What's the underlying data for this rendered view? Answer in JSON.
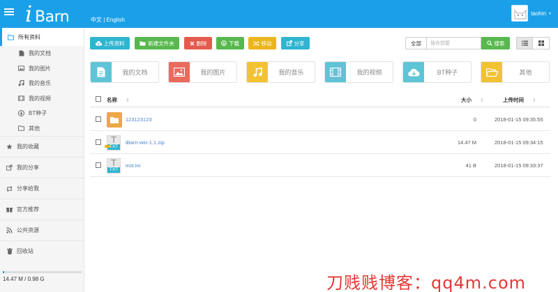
{
  "header": {
    "logo_i": "i",
    "logo_rest": "Barn",
    "lang_zh": "中文",
    "lang_sep": " | ",
    "lang_en": "English",
    "username": "taohin",
    "caret": "▾"
  },
  "sidebar": {
    "all_files": "所有资料",
    "sub_items": [
      {
        "label": "我的文档",
        "icon": "file-icon"
      },
      {
        "label": "我的图片",
        "icon": "image-icon"
      },
      {
        "label": "我的音乐",
        "icon": "music-icon"
      },
      {
        "label": "我的视频",
        "icon": "film-icon"
      },
      {
        "label": "BT种子",
        "icon": "download-circle-icon"
      },
      {
        "label": "其他",
        "icon": "folder-icon"
      }
    ],
    "main_items": [
      {
        "label": "我的收藏",
        "icon": "star-icon"
      },
      {
        "label": "我的分享",
        "icon": "share-icon"
      },
      {
        "label": "分享给我",
        "icon": "retweet-icon"
      },
      {
        "label": "官方推荐",
        "icon": "gift-icon"
      },
      {
        "label": "公共资源",
        "icon": "rss-icon"
      },
      {
        "label": "回收站",
        "icon": "trash-icon"
      }
    ],
    "storage_text": "14.47 M / 0.98 G",
    "storage_fraction": 0.0144
  },
  "toolbar": {
    "upload": "上传资料",
    "new_folder": "新建文件夹",
    "delete": "删除",
    "download": "下载",
    "move": "移动",
    "share": "分享",
    "search_scope": "全部",
    "search_placeholder": "搜你想要",
    "search_button": "搜索"
  },
  "categories": [
    {
      "label": "我的文档",
      "color": "#5ec4d6",
      "icon": "document-icon"
    },
    {
      "label": "我的图片",
      "color": "#ea6a5e",
      "icon": "picture-icon"
    },
    {
      "label": "我的音乐",
      "color": "#f1c232",
      "icon": "music-note-icon"
    },
    {
      "label": "我的视频",
      "color": "#5ec4d6",
      "icon": "video-icon"
    },
    {
      "label": "BT种子",
      "color": "#5ec4d6",
      "icon": "cloud-download-icon"
    },
    {
      "label": "其他",
      "color": "#f1c232",
      "icon": "open-folder-icon"
    }
  ],
  "table": {
    "col_name": "名称",
    "col_size": "大小",
    "col_time": "上传时间",
    "sort_glyph": "⇕",
    "rows": [
      {
        "name": "123123123",
        "size": "0",
        "time": "2018-01-15 09:35:55",
        "type": "folder"
      },
      {
        "name": "iBarn-win-1.1.zip",
        "size": "14.47 M",
        "time": "2018-01-15 09:34:15",
        "type": "txt"
      },
      {
        "name": "inst.ini",
        "size": "41 B",
        "time": "2018-01-15 09:33:37",
        "type": "txt"
      }
    ],
    "txt_glyph": "T",
    "txt_label": "TXT"
  },
  "watermark": "刀贱贱博客：qq4m.com",
  "colors": {
    "topbar": "#1aa0e8",
    "green": "#58b84e",
    "cyan": "#2fb5cf",
    "red": "#e45a4c",
    "yellow": "#ecb51c",
    "link": "#4a85c9"
  }
}
